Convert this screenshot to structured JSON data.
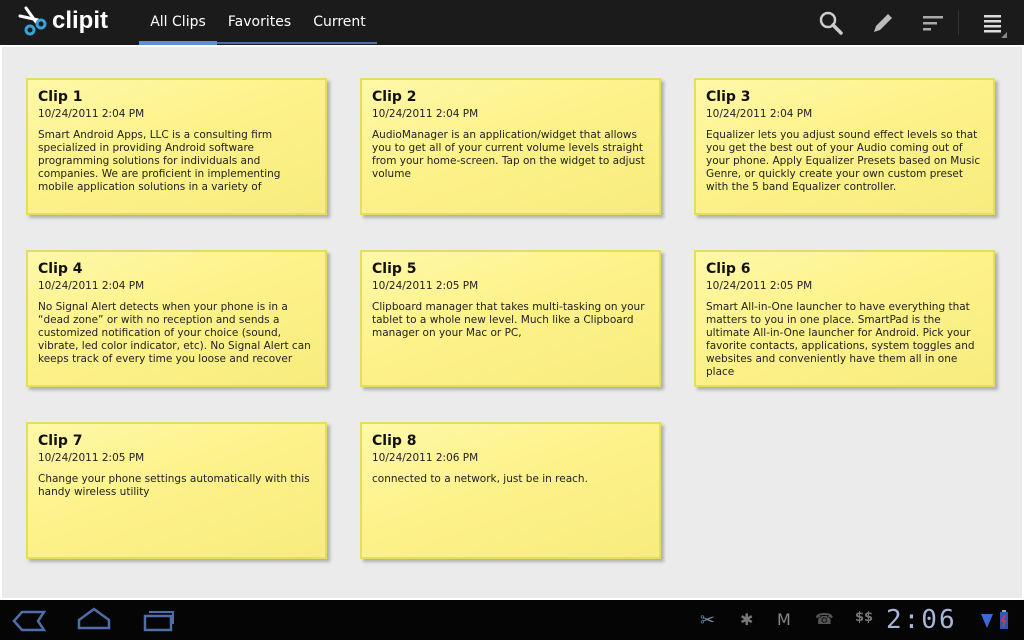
{
  "app": {
    "name": "clipit"
  },
  "tabs": [
    {
      "label": "All Clips",
      "selected": true
    },
    {
      "label": "Favorites"
    },
    {
      "label": "Current"
    }
  ],
  "actions": [
    "search-icon",
    "pencil-icon",
    "sort-icon",
    "menu-icon"
  ],
  "clips": [
    {
      "title": "Clip 1",
      "date": "10/24/2011 2:04 PM",
      "body": "Smart Android Apps, LLC is a consulting firm specialized in providing Android software programming solutions for individuals and companies. We are proficient in implementing mobile application solutions in a variety of"
    },
    {
      "title": "Clip 2",
      "date": "10/24/2011 2:04 PM",
      "body": "AudioManager is an application/widget that allows you to get all of your current volume levels straight from your home-screen. Tap on the widget to adjust volume"
    },
    {
      "title": "Clip 3",
      "date": "10/24/2011 2:04 PM",
      "body": "Equalizer lets you adjust sound effect levels so that you get the best out of your Audio coming out of your phone. Apply Equalizer Presets based on Music Genre, or quickly create your own custom preset with the 5 band Equalizer controller."
    },
    {
      "title": "Clip 4",
      "date": "10/24/2011 2:04 PM",
      "body": "No Signal Alert detects when your phone is in a “dead zone” or with no reception and sends a customized notification of your choice (sound, vibrate, led color indicator, etc). No Signal Alert can keeps track of every time you loose and recover"
    },
    {
      "title": "Clip 5",
      "date": "10/24/2011 2:05 PM",
      "body": "Clipboard manager that takes multi-tasking on your tablet to a whole new level. Much like a Clipboard manager on your Mac or PC,"
    },
    {
      "title": "Clip 6",
      "date": "10/24/2011 2:05 PM",
      "body": "Smart All-in-One launcher to have everything that matters to you in one place. SmartPad is the ultimate All-in-One launcher for Android. Pick your favorite contacts, applications, system toggles and websites and conveniently have them all in one place"
    },
    {
      "title": "Clip 7",
      "date": "10/24/2011 2:05 PM",
      "body": "Change your phone settings automatically with this handy wireless utility"
    },
    {
      "title": "Clip 8",
      "date": "10/24/2011 2:06 PM",
      "body": "connected to a network, just be in reach."
    }
  ],
  "statusbar": {
    "time": "2:06",
    "notifications": [
      "scissors-icon",
      "bug-icon",
      "gmail-icon",
      "phone-icon",
      "dollar-icon"
    ],
    "colors": {
      "accent": "#5b8fd8",
      "card": "#fdf28a"
    }
  }
}
